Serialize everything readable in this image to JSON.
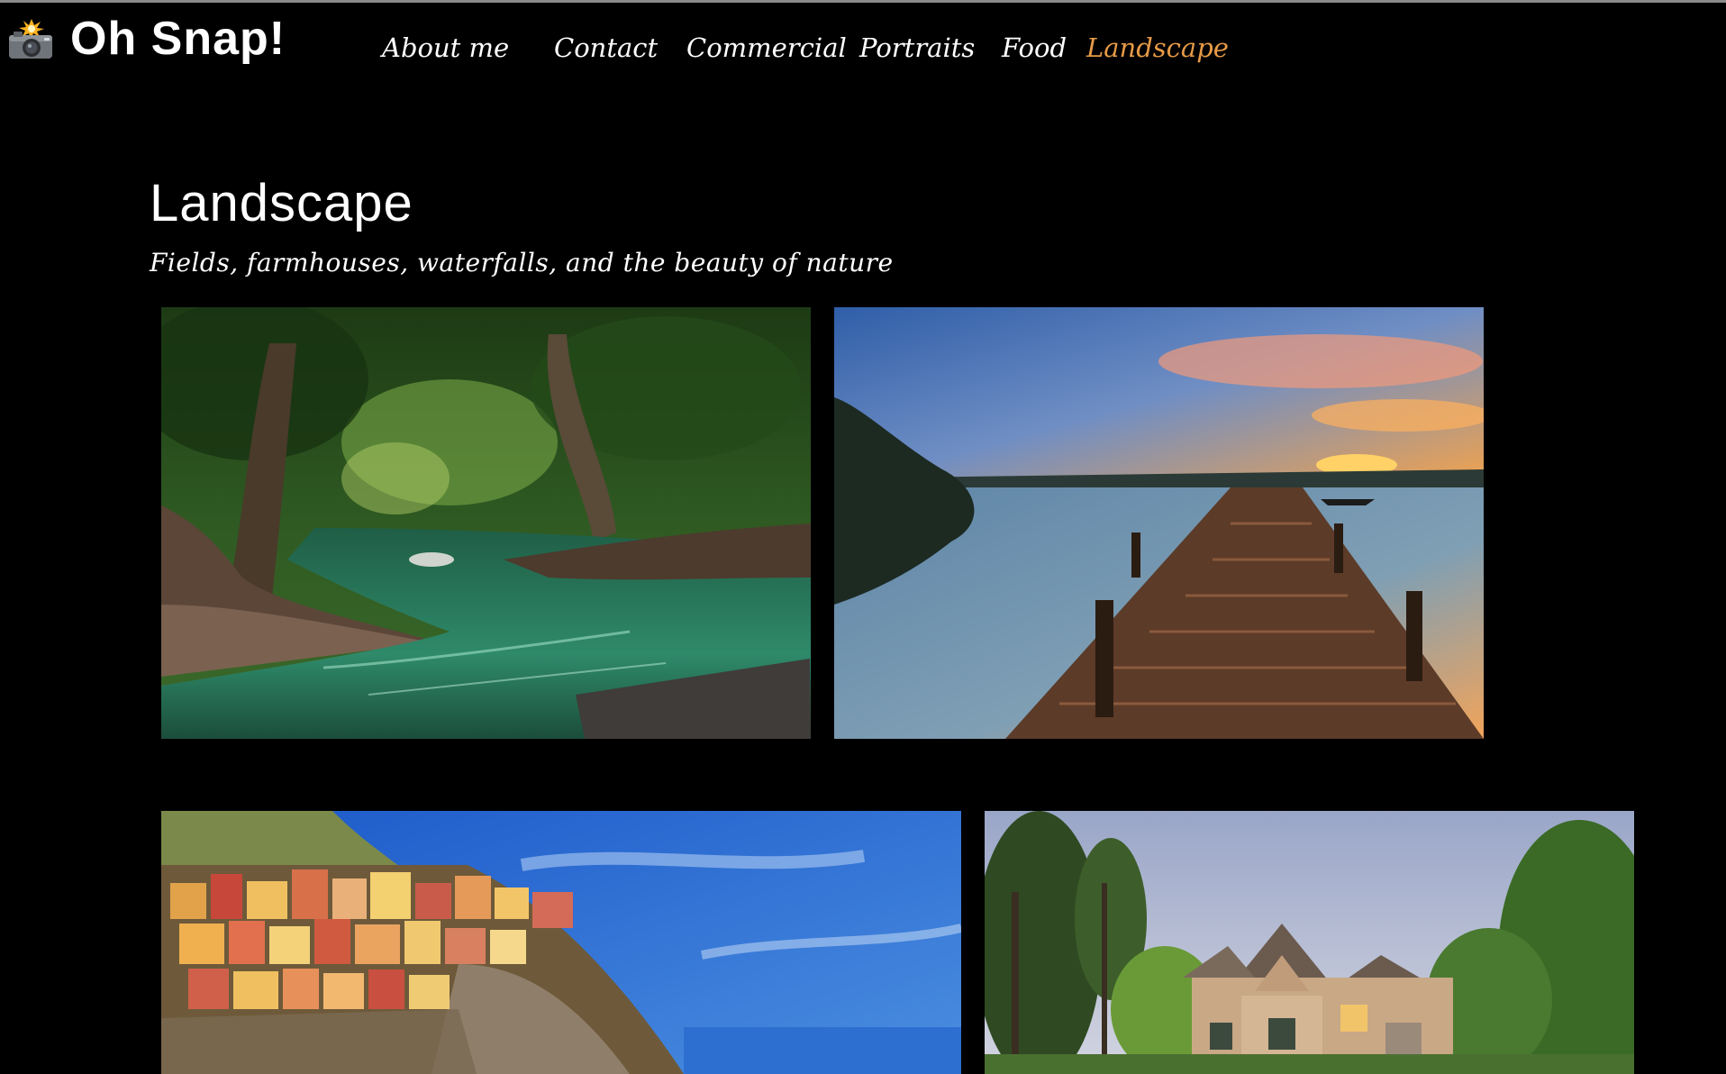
{
  "brand": {
    "title": "Oh Snap!",
    "icon": "camera-flash-icon"
  },
  "nav": {
    "items": [
      {
        "label": "About me",
        "active": false
      },
      {
        "label": "Contact",
        "active": false
      },
      {
        "label": "Commercial",
        "active": false
      },
      {
        "label": "Portraits",
        "active": false
      },
      {
        "label": "Food",
        "active": false
      },
      {
        "label": "Landscape",
        "active": true
      }
    ],
    "active_color": "#e79a47"
  },
  "page": {
    "title": "Landscape",
    "subtitle": "Fields, farmhouses, waterfalls, and the beauty of nature"
  },
  "colors": {
    "background": "#000000",
    "text": "#ffffff",
    "accent": "#e79a47"
  },
  "gallery": {
    "photos": [
      {
        "subject": "forest river"
      },
      {
        "subject": "lake pier at sunset"
      },
      {
        "subject": "cliffside village by the sea"
      },
      {
        "subject": "stone house among trees"
      }
    ]
  }
}
